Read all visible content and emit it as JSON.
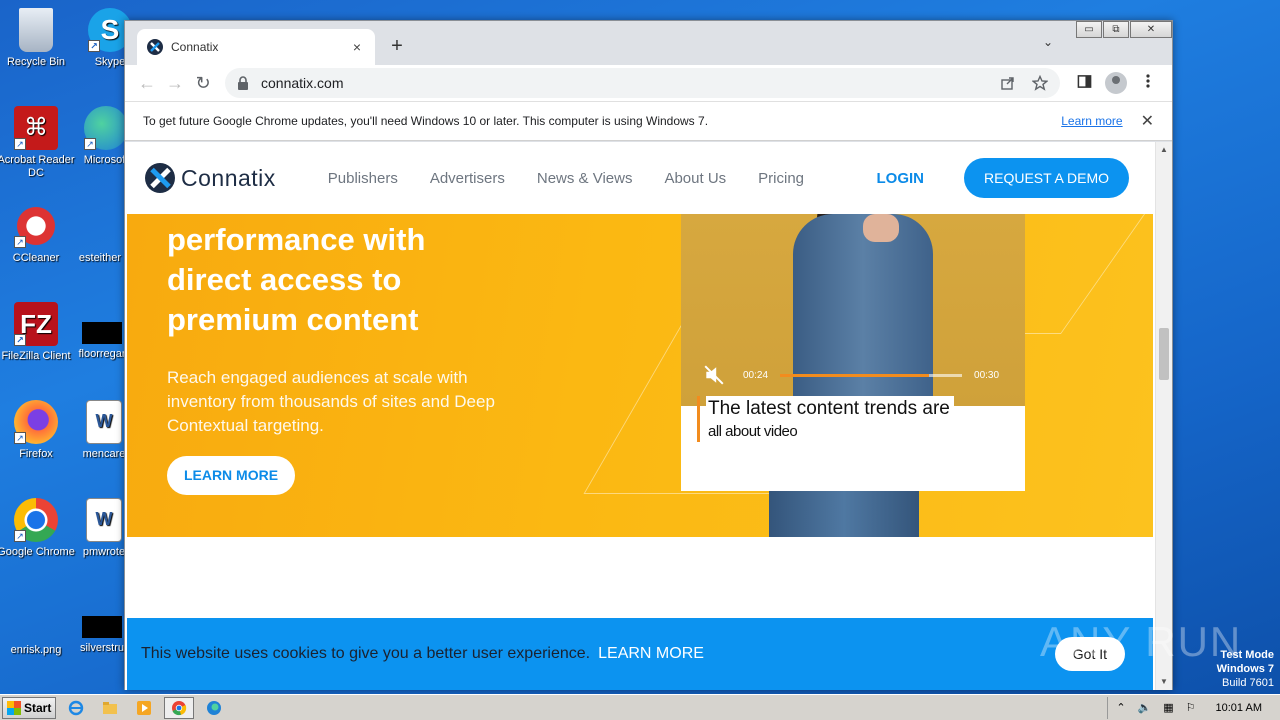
{
  "desktop": {
    "icons": [
      {
        "label": "Recycle Bin"
      },
      {
        "label": "Skype"
      },
      {
        "label": "Acrobat Reader DC"
      },
      {
        "label": "Microsoft"
      },
      {
        "label": "CCleaner"
      },
      {
        "label": "esteither"
      },
      {
        "label": "FileZilla Client"
      },
      {
        "label": "floorregar"
      },
      {
        "label": "Firefox"
      },
      {
        "label": "mencare"
      },
      {
        "label": "Google Chrome"
      },
      {
        "label": "pmwrote"
      },
      {
        "label": "enrisk.png"
      },
      {
        "label": "silverstru"
      }
    ],
    "watermark": "ANY RUN",
    "test_mode": {
      "line1": "Test Mode",
      "line2": "Windows 7",
      "line3": "Build 7601"
    }
  },
  "browser": {
    "tab": {
      "title": "Connatix",
      "close": "×"
    },
    "new_tab": "+",
    "tab_dropdown": "⌄",
    "window_controls": {
      "minimize": "▭",
      "restore": "⧉",
      "close": "✕"
    },
    "toolbar": {
      "back": "←",
      "forward": "→",
      "reload": "↻",
      "url": "connatix.com"
    },
    "infobar": {
      "message": "To get future Google Chrome updates, you'll need Windows 10 or later. This computer is using Windows 7.",
      "link": "Learn more",
      "close": "✕"
    }
  },
  "site": {
    "logo_text": "Connatix",
    "nav": [
      "Publishers",
      "Advertisers",
      "News & Views",
      "About Us",
      "Pricing"
    ],
    "login": "LOGIN",
    "demo_button": "REQUEST A DEMO",
    "hero": {
      "headline": [
        "performance with",
        "direct access to",
        "premium content"
      ],
      "body": "Reach engaged audiences at scale with inventory from thousands of sites and Deep Contextual targeting.",
      "learn_more": "LEARN MORE"
    },
    "video": {
      "time_current": "00:24",
      "time_total": "00:30",
      "progress": 0.82,
      "caption_line1": "The latest content trends are",
      "caption_line2": "all about video"
    },
    "cookie": {
      "message": "This website uses cookies to give you a better user experience.",
      "learn_more": "LEARN MORE",
      "got_it": "Got It"
    }
  },
  "taskbar": {
    "start": "Start",
    "clock": "10:01 AM"
  },
  "colors": {
    "brand_blue": "#0c93f0",
    "hero_yellow": "#fbb812",
    "brand_navy": "#1e2d45",
    "progress_orange": "#f28c1e"
  }
}
